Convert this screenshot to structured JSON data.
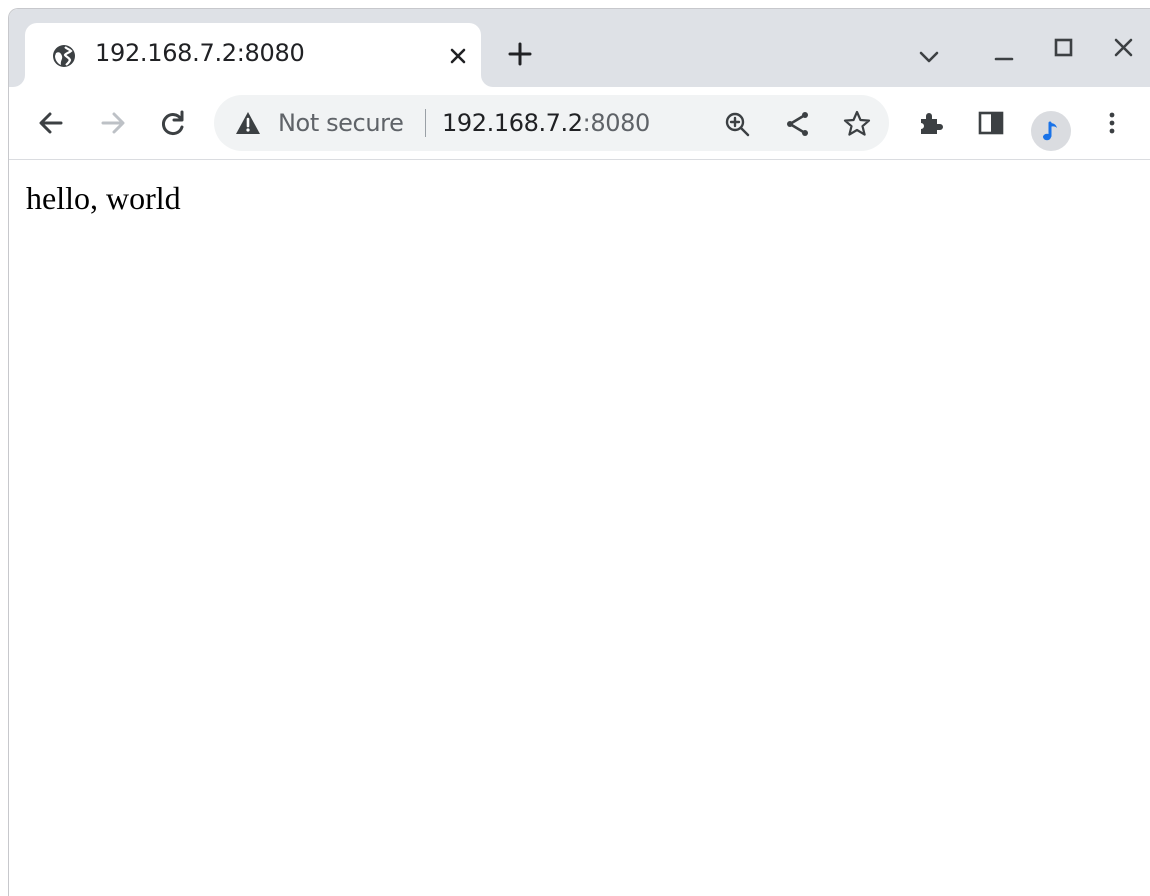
{
  "tab": {
    "title": "192.168.7.2:8080",
    "favicon": "globe-icon"
  },
  "omnibox": {
    "security_label": "Not secure",
    "url_host": "192.168.7.2",
    "url_port": ":8080"
  },
  "page": {
    "body_text": "hello, world"
  },
  "colors": {
    "tabstrip": "#dee1e6",
    "omnibox_bg": "#f1f3f4",
    "icon": "#5f6368",
    "avatar_accent": "#1a73e8"
  }
}
